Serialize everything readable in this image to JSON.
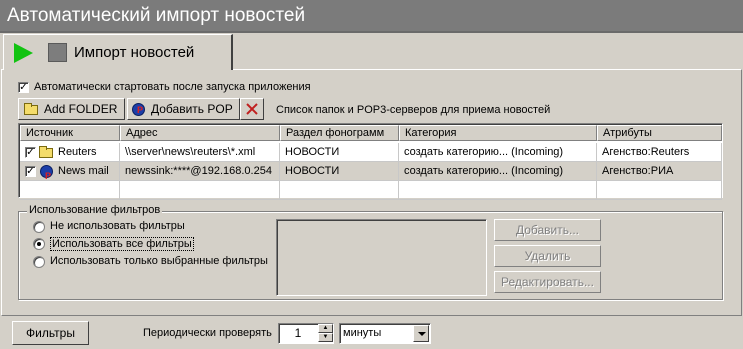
{
  "window": {
    "title": "Автоматический импорт новостей"
  },
  "tab": {
    "label": "Импорт новостей",
    "play_icon": "play-icon",
    "stop_icon": "stop-icon",
    "play_color": "#12c312"
  },
  "autostart": {
    "label": "Автоматически стартовать после запуска приложения",
    "checked": true
  },
  "toolbar": {
    "add_folder_label": "Add FOLDER",
    "add_pop_label": "Добавить POP",
    "delete_icon": "delete-x-icon",
    "caption": "Список папок и POP3-серверов для приема новостей"
  },
  "table": {
    "columns": [
      "Источник",
      "Адрес",
      "Раздел фонограмм",
      "Категория",
      "Атрибуты"
    ],
    "rows": [
      {
        "checked": true,
        "icon": "folder-icon",
        "source": "Reuters",
        "address": "\\\\server\\news\\reuters\\*.xml",
        "section": "НОВОСТИ",
        "category": "создать категорию... (Incoming)",
        "attributes": "Агенство:Reuters"
      },
      {
        "checked": true,
        "icon": "pop-mail-icon",
        "source": "News mail",
        "address": "newssink:****@192.168.0.254",
        "section": "НОВОСТИ",
        "category": "создать категорию... (Incoming)",
        "attributes": "Агенство:РИА"
      }
    ]
  },
  "filters": {
    "group_title": "Использование фильтров",
    "options": [
      "Не использовать фильтры",
      "Использовать все фильтры",
      "Использовать только выбранные фильтры"
    ],
    "selected_index": 1,
    "add_label": "Добавить...",
    "remove_label": "Удалить",
    "edit_label": "Редактировать..."
  },
  "bottom": {
    "filters_button": "Фильтры",
    "check_label": "Периодически проверять",
    "interval_value": "1",
    "unit_value": "минуты"
  }
}
